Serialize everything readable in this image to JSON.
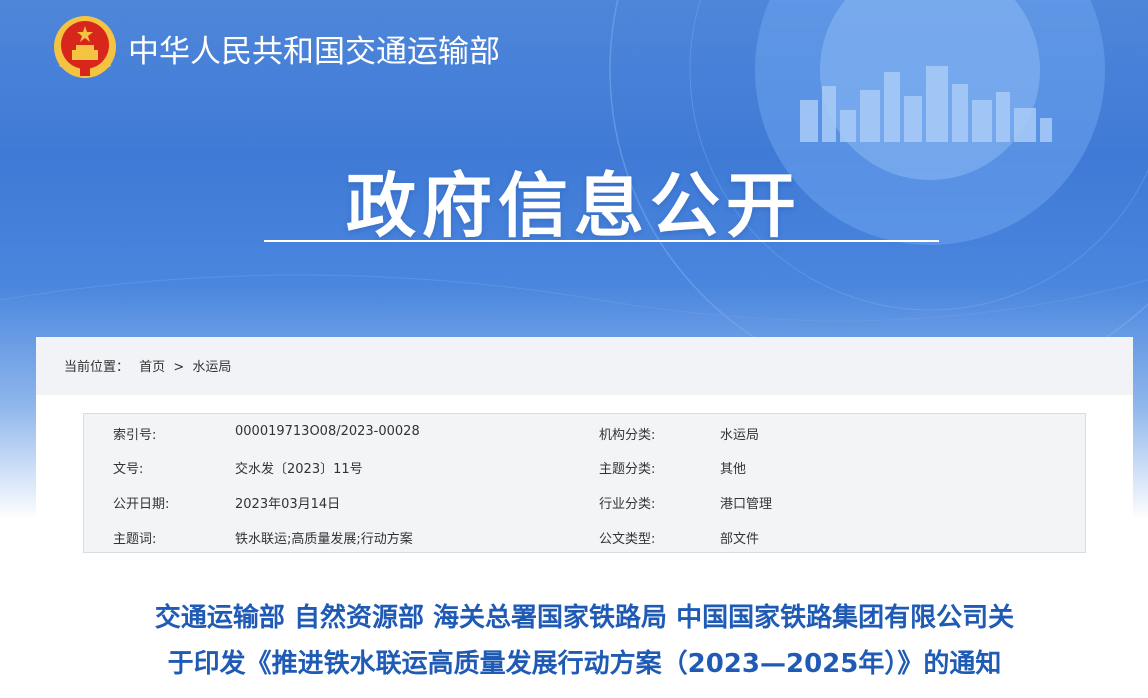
{
  "header": {
    "site_title": "中华人民共和国交通运输部",
    "hero_title": "政府信息公开",
    "emblem_icon": "national-emblem-icon"
  },
  "breadcrumb": {
    "prefix": "当前位置：",
    "home": "首页",
    "separator": ">",
    "current": "水运局"
  },
  "meta": {
    "rows": [
      {
        "label1": "索引号:",
        "value1": "000019713O08/2023-00028",
        "label2": "机构分类:",
        "value2": "水运局"
      },
      {
        "label1": "文号:",
        "value1": "交水发〔2023〕11号",
        "label2": "主题分类:",
        "value2": "其他"
      },
      {
        "label1": "公开日期:",
        "value1": "2023年03月14日",
        "label2": "行业分类:",
        "value2": "港口管理"
      },
      {
        "label1": "主题词:",
        "value1": "铁水联运;高质量发展;行动方案",
        "label2": "公文类型:",
        "value2": "部文件"
      }
    ]
  },
  "document": {
    "title_line1": "交通运输部 自然资源部 海关总署国家铁路局 中国国家铁路集团有限公司关",
    "title_line2": "于印发《推进铁水联运高质量发展行动方案（2023—2025年）》的通知"
  },
  "colors": {
    "banner_blue": "#4a86de",
    "title_blue": "#1f5bb5",
    "emblem_red": "#d8261d",
    "emblem_gold": "#f5c342"
  }
}
